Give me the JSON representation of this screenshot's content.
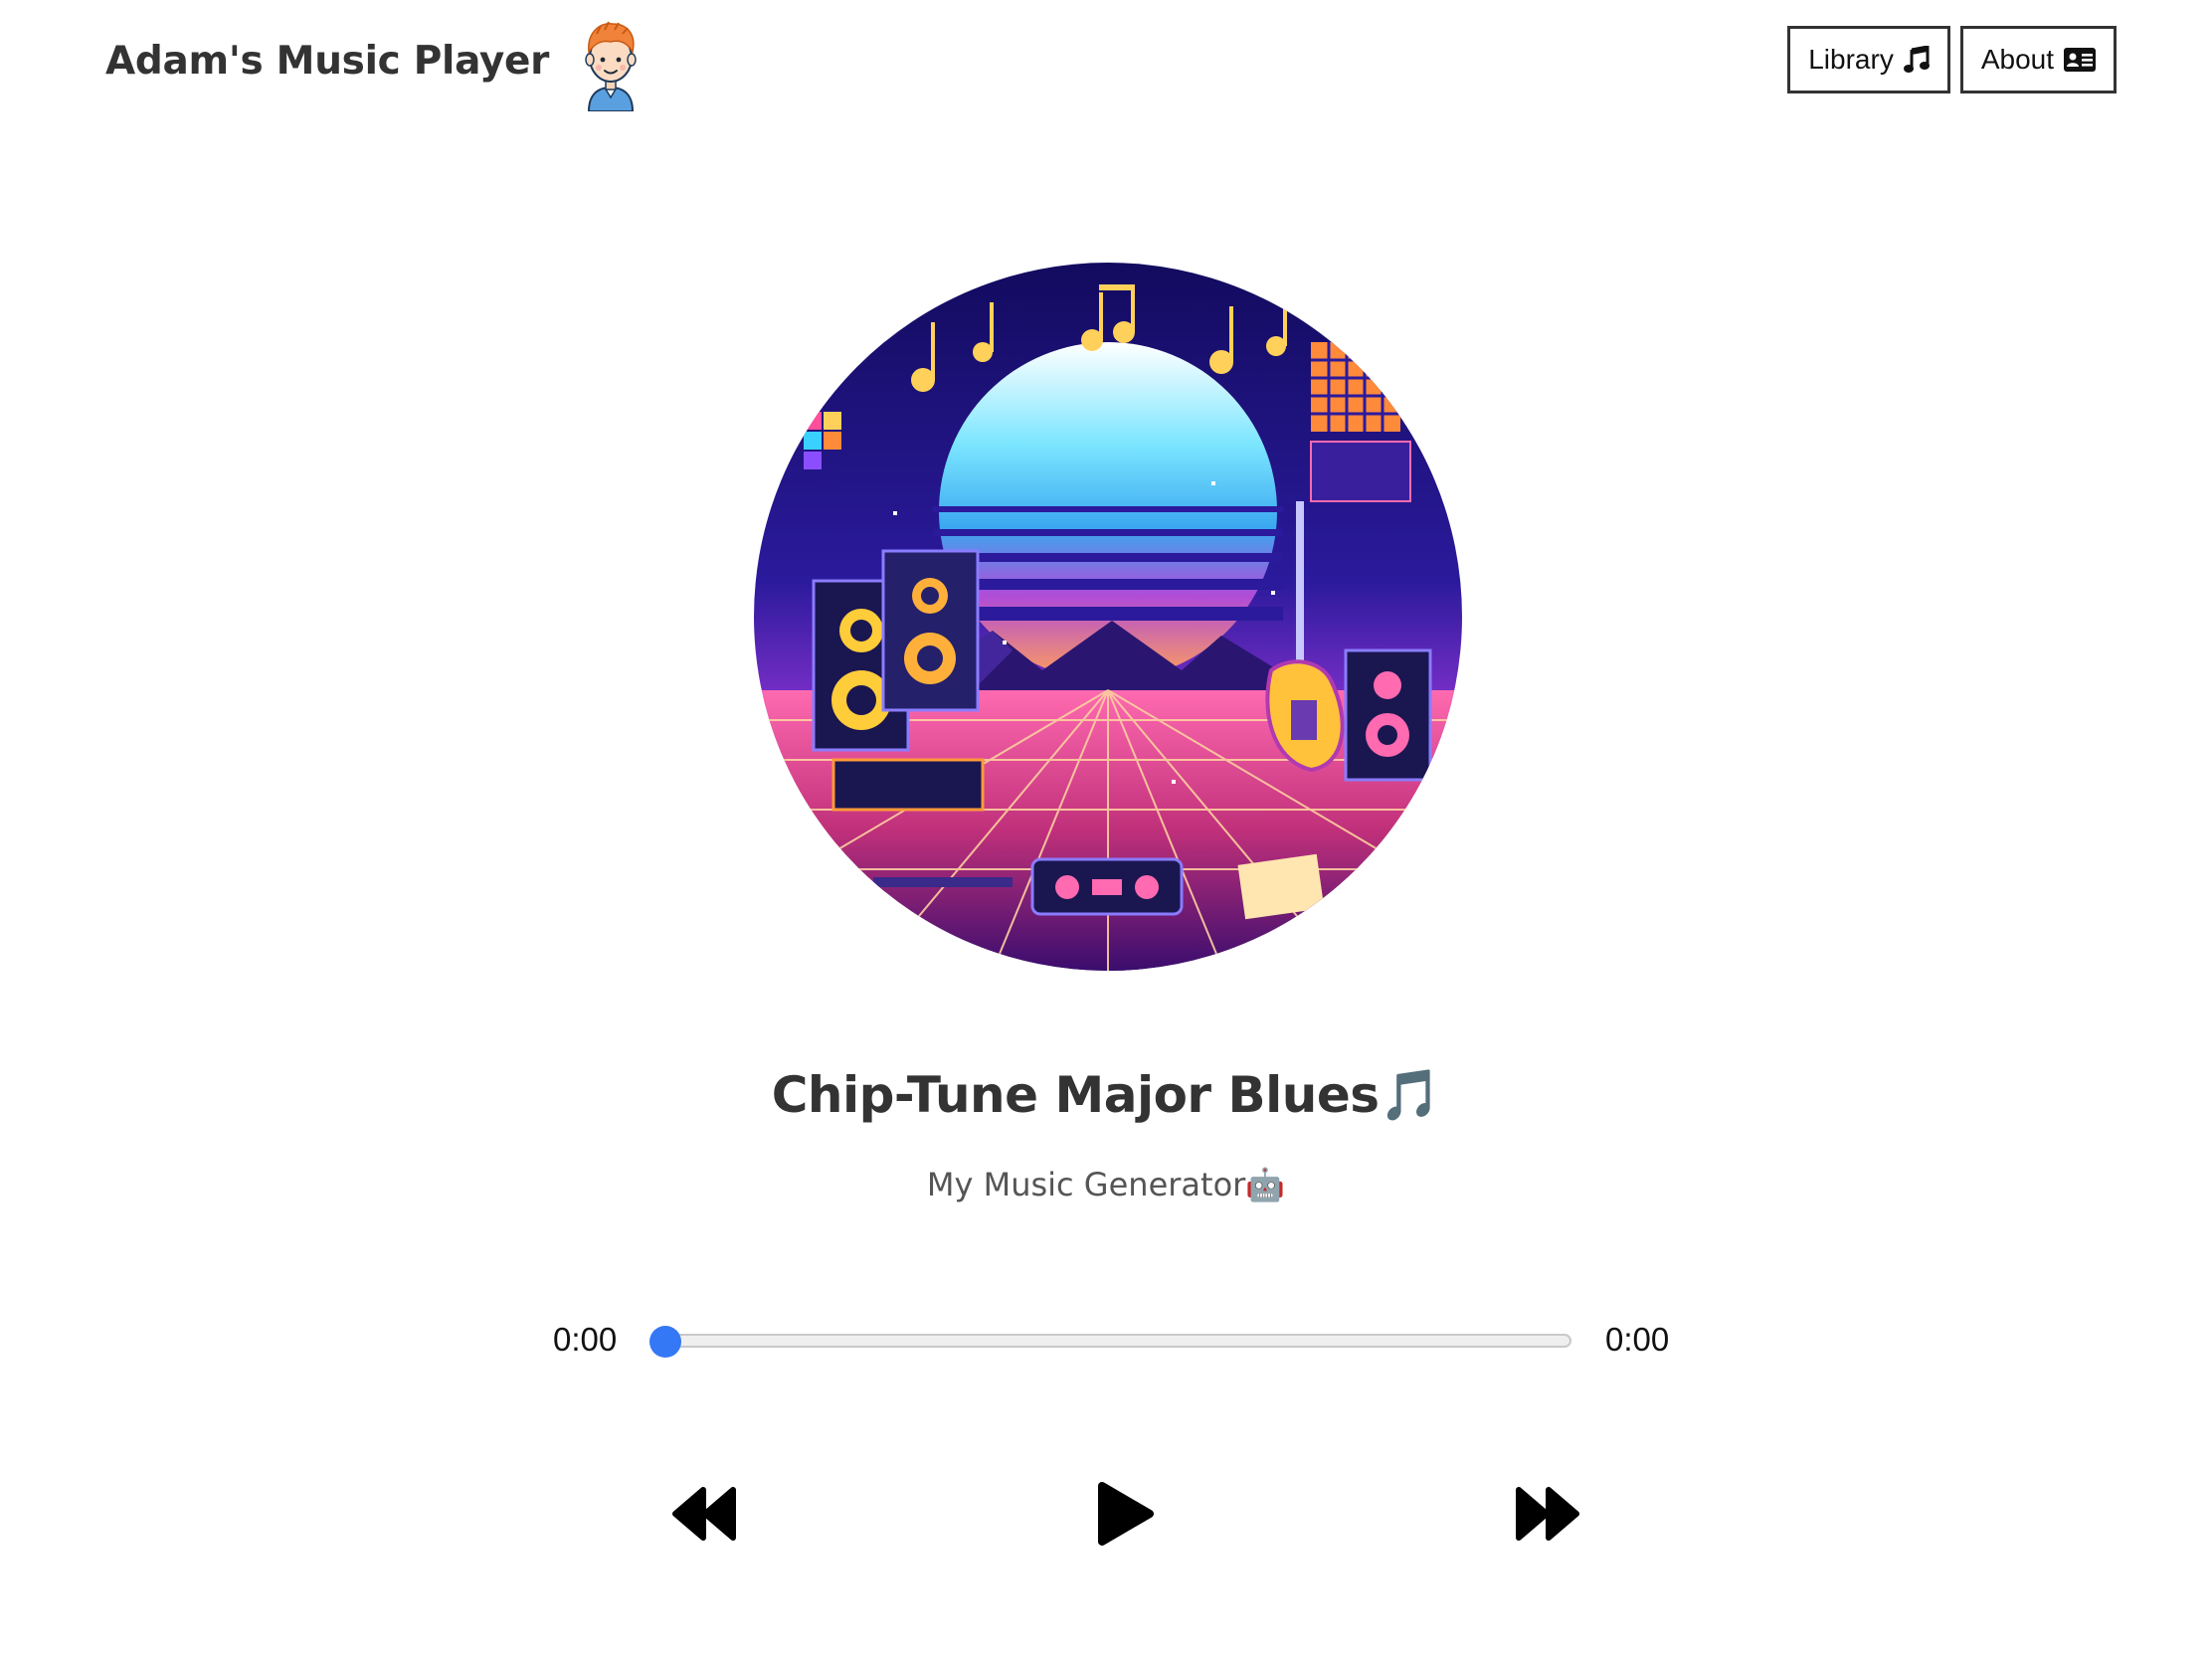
{
  "header": {
    "title": "Adam's Music Player",
    "avatar_icon": "boy-avatar-icon",
    "nav": [
      {
        "label": "Library",
        "icon": "music-note-icon"
      },
      {
        "label": "About",
        "icon": "id-card-icon"
      }
    ]
  },
  "track": {
    "title": "Chip-Tune Major Blues",
    "title_emoji": "🎵",
    "artist": "My Music Generator",
    "artist_emoji": "🤖",
    "cover_icon": "synthwave-retro-cover-art"
  },
  "progress": {
    "current": "0:00",
    "total": "0:00",
    "fraction": 0
  },
  "controls": {
    "prev_icon": "rewind-icon",
    "play_icon": "play-icon",
    "next_icon": "fast-forward-icon"
  },
  "colors": {
    "accent": "#3478f6",
    "text": "#333333"
  }
}
